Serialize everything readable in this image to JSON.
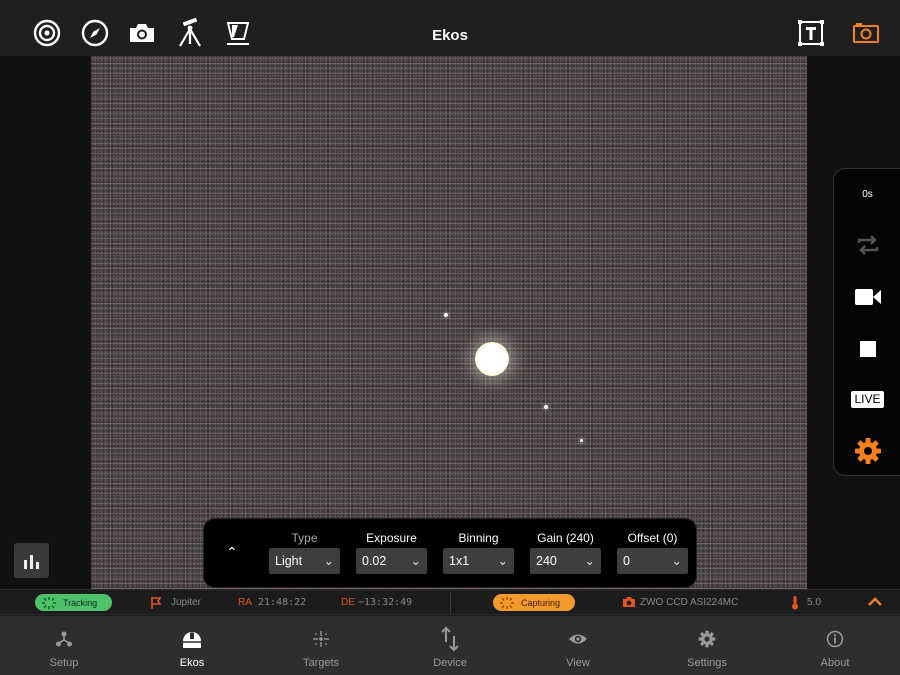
{
  "app": {
    "title": "Ekos"
  },
  "top_toolbar": {
    "left_icons": [
      "target-icon",
      "compass-icon",
      "camera-icon",
      "tripod-icon",
      "flat-panel-icon"
    ],
    "right_icons": [
      "text-frame-icon",
      "screen-camera-icon"
    ]
  },
  "side_panel": {
    "timer": "0s",
    "live_label": "LIVE",
    "accent_color": "#f4801f"
  },
  "capture_panel": {
    "type": {
      "label": "Type",
      "value": "Light"
    },
    "exposure": {
      "label": "Exposure",
      "value": "0.02"
    },
    "binning": {
      "label": "Binning",
      "value": "1x1"
    },
    "gain": {
      "label": "Gain (240)",
      "value": "240"
    },
    "offset": {
      "label": "Offset (0)",
      "value": "0"
    }
  },
  "status_bar": {
    "mount_status": "Tracking",
    "target": "Jupiter",
    "ra_label": "RA",
    "ra_value": "21:48:22",
    "de_label": "DE",
    "de_value": "−13:32:49",
    "capture_status": "Capturing",
    "camera": "ZWO CCD ASI224MC",
    "temperature": "5.0",
    "colors": {
      "tracking": "#4fc16a",
      "capturing": "#f39a2c",
      "label": "#e2551b"
    }
  },
  "tabs": [
    {
      "label": "Setup",
      "icon": "setup-icon"
    },
    {
      "label": "Ekos",
      "icon": "dome-icon",
      "active": true
    },
    {
      "label": "Targets",
      "icon": "targets-icon"
    },
    {
      "label": "Device",
      "icon": "device-arrows-icon"
    },
    {
      "label": "View",
      "icon": "eye-icon"
    },
    {
      "label": "Settings",
      "icon": "gear-icon"
    },
    {
      "label": "About",
      "icon": "info-icon"
    }
  ]
}
